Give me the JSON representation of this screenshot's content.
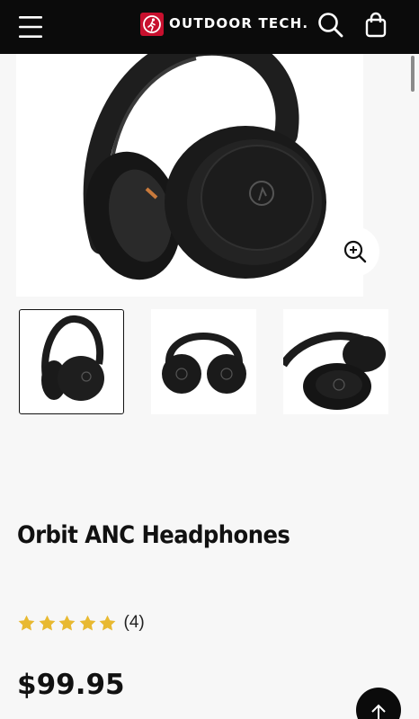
{
  "header": {
    "brand": "OUTDOOR TECH.",
    "icons": {
      "menu": "hamburger-menu-icon",
      "logo": "outdoor-tech-logo-icon",
      "search": "search-icon",
      "cart": "shopping-bag-icon"
    },
    "background": "#0b0b0b",
    "brand_color": "#c8102e"
  },
  "gallery": {
    "zoom_icon": "zoom-in-icon",
    "thumbnails": [
      {
        "view": "front-angle",
        "selected": true
      },
      {
        "view": "folded-top"
      },
      {
        "view": "side-lying"
      }
    ]
  },
  "product": {
    "title": "Orbit ANC Headphones",
    "rating": {
      "stars": 5,
      "max": 5,
      "count_label": "(4)",
      "star_color": "#e8b931"
    },
    "price": "$99.95"
  },
  "back_to_top_icon": "arrow-up-icon"
}
